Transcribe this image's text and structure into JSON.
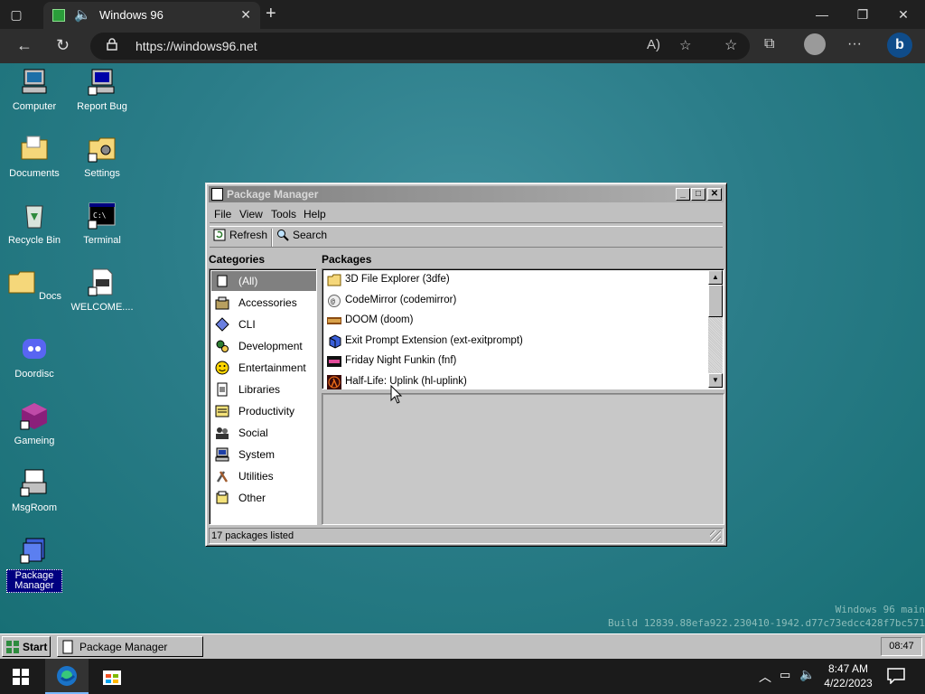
{
  "browser": {
    "tab_title": "Windows 96",
    "url": "https://windows96.net"
  },
  "desktop": {
    "icons": [
      {
        "label": "Computer"
      },
      {
        "label": "Report Bug"
      },
      {
        "label": "Documents"
      },
      {
        "label": "Settings"
      },
      {
        "label": "Recycle Bin"
      },
      {
        "label": "Terminal"
      },
      {
        "label": "Docs"
      },
      {
        "label": "WELCOME...."
      },
      {
        "label": "Doordisc"
      },
      {
        "label": "Gameing"
      },
      {
        "label": "MsgRoom"
      },
      {
        "label": "Package Manager"
      }
    ],
    "watermark_line1": "Windows 96 main",
    "watermark_line2": "Build 12839.88efa922.230410-1942.d77c73edcc428f7bc571"
  },
  "package_manager": {
    "title": "Package Manager",
    "menu": [
      "File",
      "View",
      "Tools",
      "Help"
    ],
    "toolbar": {
      "refresh": "Refresh",
      "search": "Search"
    },
    "categories_header": "Categories",
    "packages_header": "Packages",
    "categories": [
      "(All)",
      "Accessories",
      "CLI",
      "Development",
      "Entertainment",
      "Libraries",
      "Productivity",
      "Social",
      "System",
      "Utilities",
      "Other"
    ],
    "selected_category": "(All)",
    "packages": [
      "3D File Explorer (3dfe)",
      "CodeMirror (codemirror)",
      "DOOM (doom)",
      "Exit Prompt Extension (ext-exitprompt)",
      "Friday Night Funkin (fnf)",
      "Half-Life: Uplink (hl-uplink)"
    ],
    "status": "17 packages listed"
  },
  "w96_taskbar": {
    "start": "Start",
    "task": "Package Manager",
    "clock": "08:47"
  },
  "os_taskbar": {
    "time": "8:47 AM",
    "date": "4/22/2023"
  },
  "colors": {
    "desktop_teal": "#2b7d89",
    "win_gray": "#c0c0c0",
    "selection_navy": "#000080",
    "bing_blue": "#1a73c8"
  }
}
